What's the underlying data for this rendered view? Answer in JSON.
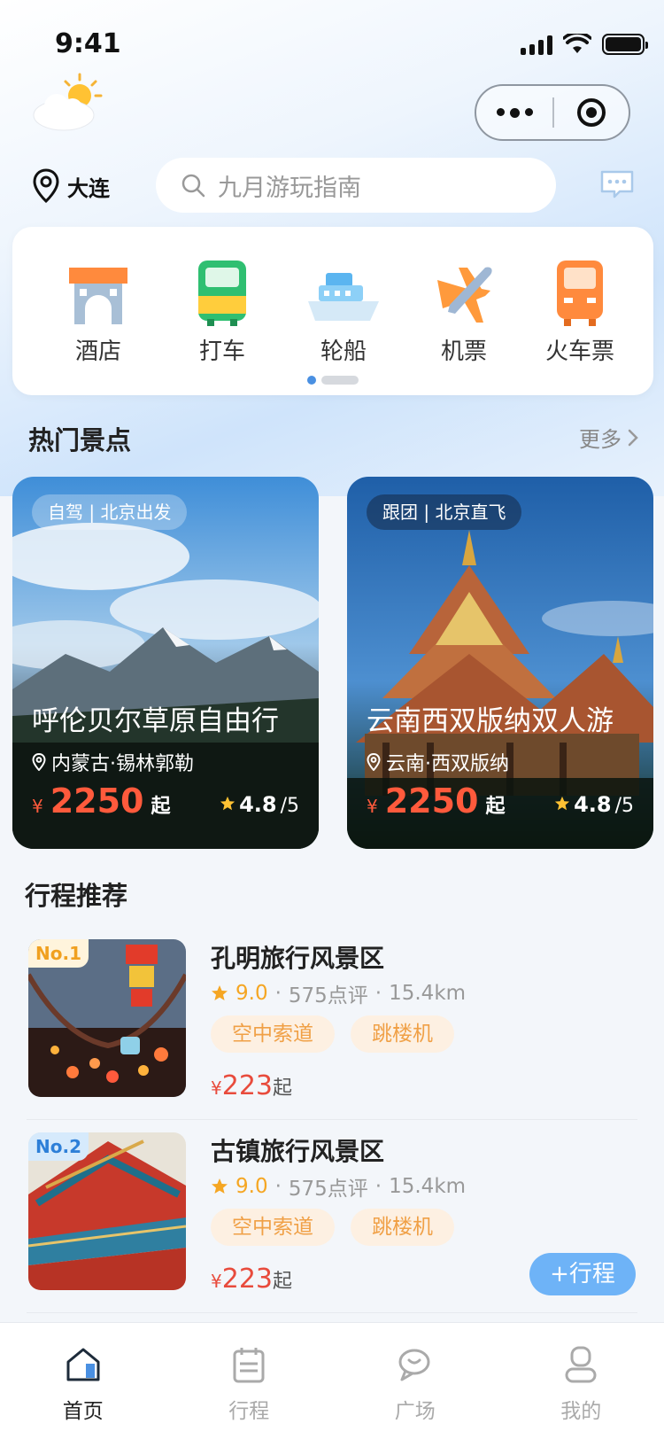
{
  "status_bar": {
    "time": "9:41"
  },
  "header": {
    "city": "大连",
    "search_placeholder": "九月游玩指南"
  },
  "quick_entries": [
    {
      "label": "酒店",
      "icon": "hotel-icon"
    },
    {
      "label": "打车",
      "icon": "taxi-icon"
    },
    {
      "label": "轮船",
      "icon": "ship-icon"
    },
    {
      "label": "机票",
      "icon": "plane-icon"
    },
    {
      "label": "火车票",
      "icon": "train-icon"
    }
  ],
  "hot_section": {
    "title": "热门景点",
    "more": "更多",
    "cards": [
      {
        "tag": "自驾 | 北京出发",
        "name": "呼伦贝尔草原自由行",
        "place": "内蒙古·锡林郭勒",
        "currency": "¥",
        "price": "2250",
        "suffix": "起",
        "score": "4.8",
        "max": "/5"
      },
      {
        "tag": "跟团 | 北京直飞",
        "name": "云南西双版纳双人游",
        "place": "云南·西双版纳",
        "currency": "¥",
        "price": "2250",
        "suffix": "起",
        "score": "4.8",
        "max": "/5"
      }
    ]
  },
  "recommend_section": {
    "title": "行程推荐",
    "items": [
      {
        "rank": "No.1",
        "title": "孔明旅行风景区",
        "score": "9.0",
        "reviews": "575点评",
        "distance": "15.4km",
        "chips": [
          "空中索道",
          "跳楼机"
        ],
        "currency": "¥",
        "price": "223",
        "suffix": "起"
      },
      {
        "rank": "No.2",
        "title": "古镇旅行风景区",
        "score": "9.0",
        "reviews": "575点评",
        "distance": "15.4km",
        "chips": [
          "空中索道",
          "跳楼机"
        ],
        "currency": "¥",
        "price": "223",
        "suffix": "起",
        "action": "+行程"
      }
    ]
  },
  "tabbar": [
    {
      "label": "首页",
      "icon": "home-icon",
      "active": true
    },
    {
      "label": "行程",
      "icon": "itinerary-icon",
      "active": false
    },
    {
      "label": "广场",
      "icon": "plaza-icon",
      "active": false
    },
    {
      "label": "我的",
      "icon": "profile-icon",
      "active": false
    }
  ],
  "colors": {
    "accent": "#4a90e2",
    "price": "#ff5a3c",
    "star": "#f5a623"
  }
}
